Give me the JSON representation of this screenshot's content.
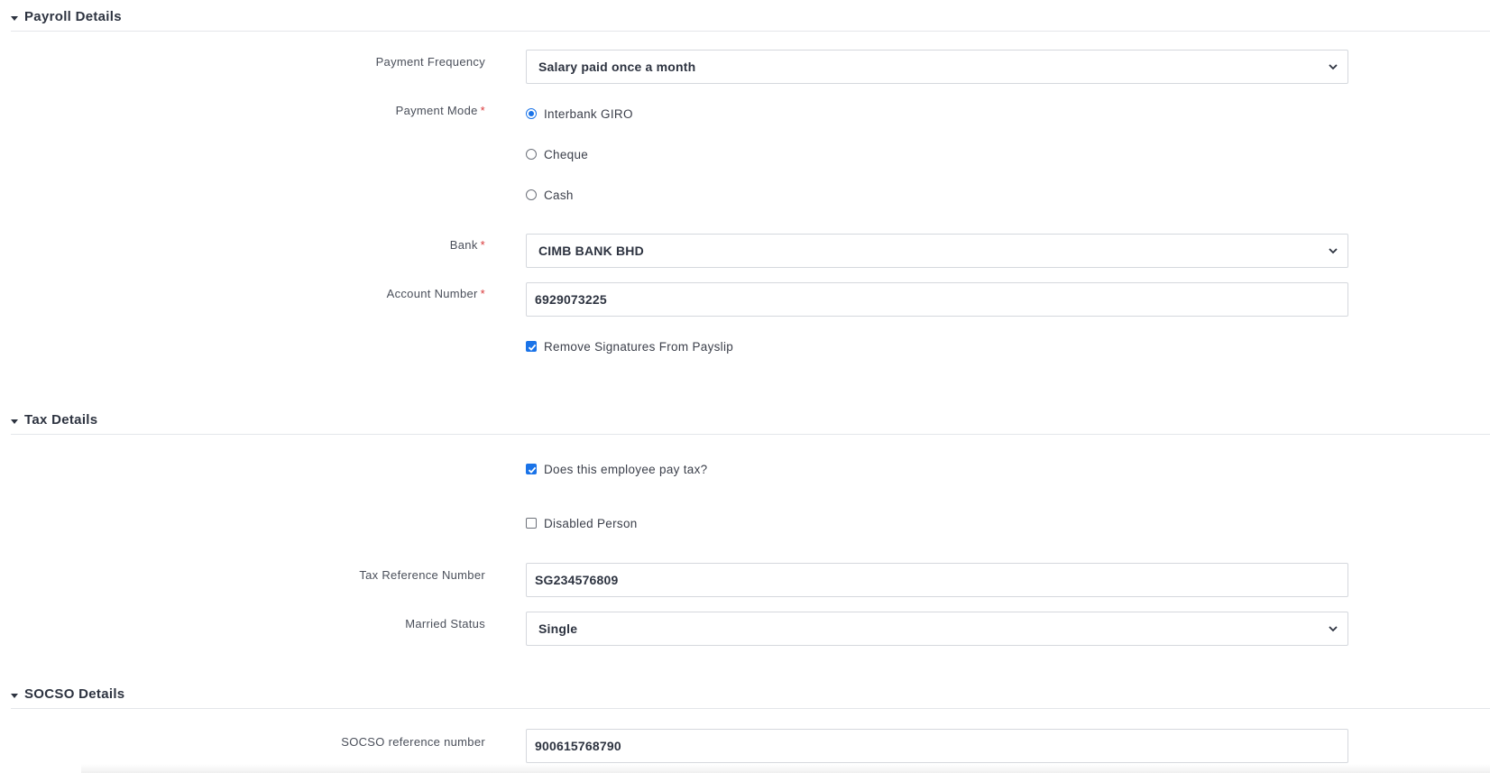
{
  "sections": {
    "payroll": {
      "title": "Payroll Details"
    },
    "tax": {
      "title": "Tax Details"
    },
    "socso": {
      "title": "SOCSO Details"
    }
  },
  "payroll": {
    "payment_frequency": {
      "label": "Payment Frequency",
      "value": "Salary paid once a month"
    },
    "payment_mode": {
      "label": "Payment Mode",
      "options": [
        "Interbank GIRO",
        "Cheque",
        "Cash"
      ],
      "selected": "Interbank GIRO"
    },
    "bank": {
      "label": "Bank",
      "value": "CIMB BANK BHD"
    },
    "account_number": {
      "label": "Account Number",
      "value": "6929073225"
    },
    "remove_signatures": {
      "label": "Remove Signatures From Payslip",
      "checked": true
    }
  },
  "tax": {
    "pays_tax": {
      "label": "Does this employee pay tax?",
      "checked": true
    },
    "disabled_person": {
      "label": "Disabled Person",
      "checked": false
    },
    "tax_reference_number": {
      "label": "Tax Reference Number",
      "value": "SG234576809"
    },
    "married_status": {
      "label": "Married Status",
      "value": "Single"
    }
  },
  "socso": {
    "reference_number": {
      "label": "SOCSO reference number",
      "value": "900615768790"
    }
  },
  "required_marker": "*",
  "colors": {
    "accent": "#1a73e8",
    "required": "#d9383a",
    "border": "#d5d8dd"
  }
}
